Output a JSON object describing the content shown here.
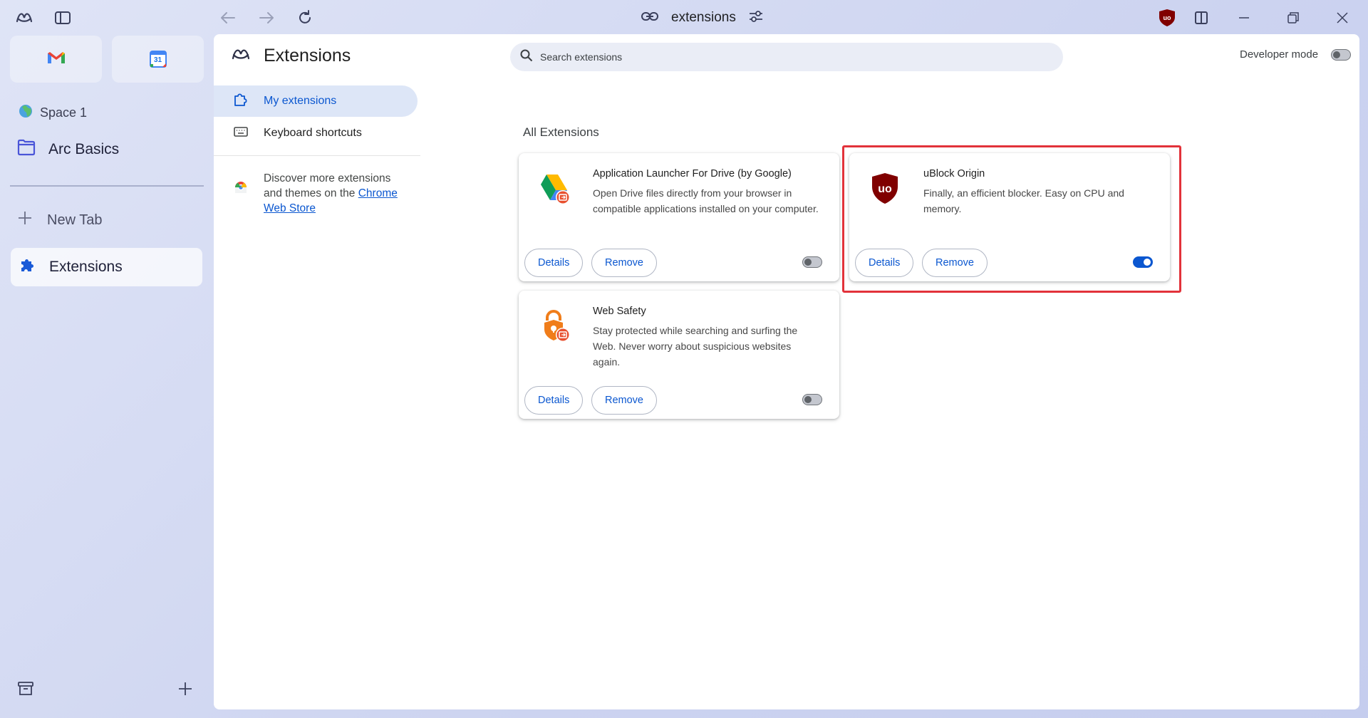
{
  "window": {
    "url_text": "extensions",
    "arc_logo_icon": "arc-logo-icon",
    "sidebar_toggle_icon": "sidebar-toggle-icon",
    "back_icon": "arrow-left-icon",
    "forward_icon": "arrow-right-icon",
    "reload_icon": "reload-icon",
    "link_icon": "link-icon",
    "site_settings_icon": "sliders-icon",
    "ublock_toolbar_icon": "ublock-icon",
    "split_view_icon": "split-view-icon",
    "minimize_icon": "minimize-icon",
    "restore_icon": "restore-icon",
    "close_icon": "close-icon"
  },
  "sidebar": {
    "pinned": [
      {
        "name": "Gmail",
        "icon": "gmail-icon"
      },
      {
        "name": "Google Calendar",
        "icon": "calendar-icon",
        "badge": "31"
      }
    ],
    "space_label": "Space 1",
    "folder_label": "Arc Basics",
    "new_tab_label": "New Tab",
    "active_tab_label": "Extensions",
    "archive_icon": "archive-icon",
    "add_icon": "plus-icon"
  },
  "page": {
    "title": "Extensions",
    "search_placeholder": "Search extensions",
    "developer_mode_label": "Developer mode",
    "developer_mode_on": false,
    "nav": {
      "my_extensions": "My extensions",
      "keyboard_shortcuts": "Keyboard shortcuts"
    },
    "promo": {
      "text": "Discover more extensions and themes on the ",
      "link": "Chrome Web Store"
    },
    "section_title": "All Extensions",
    "extensions": [
      {
        "name": "Application Launcher For Drive (by Google)",
        "description": "Open Drive files directly from your browser in compatible applications installed on your computer.",
        "details": "Details",
        "remove": "Remove",
        "enabled": false,
        "icon": "google-drive-icon"
      },
      {
        "name": "uBlock Origin",
        "description": "Finally, an efficient blocker. Easy on CPU and memory.",
        "details": "Details",
        "remove": "Remove",
        "enabled": true,
        "icon": "ublock-origin-icon"
      },
      {
        "name": "Web Safety",
        "description": "Stay protected while searching and surfing the Web. Never worry about suspicious websites again.",
        "details": "Details",
        "remove": "Remove",
        "enabled": false,
        "icon": "web-safety-lock-icon"
      }
    ]
  },
  "colors": {
    "accent": "#0b57d0",
    "highlight_border": "#e2323a",
    "ublock_red": "#800000"
  }
}
